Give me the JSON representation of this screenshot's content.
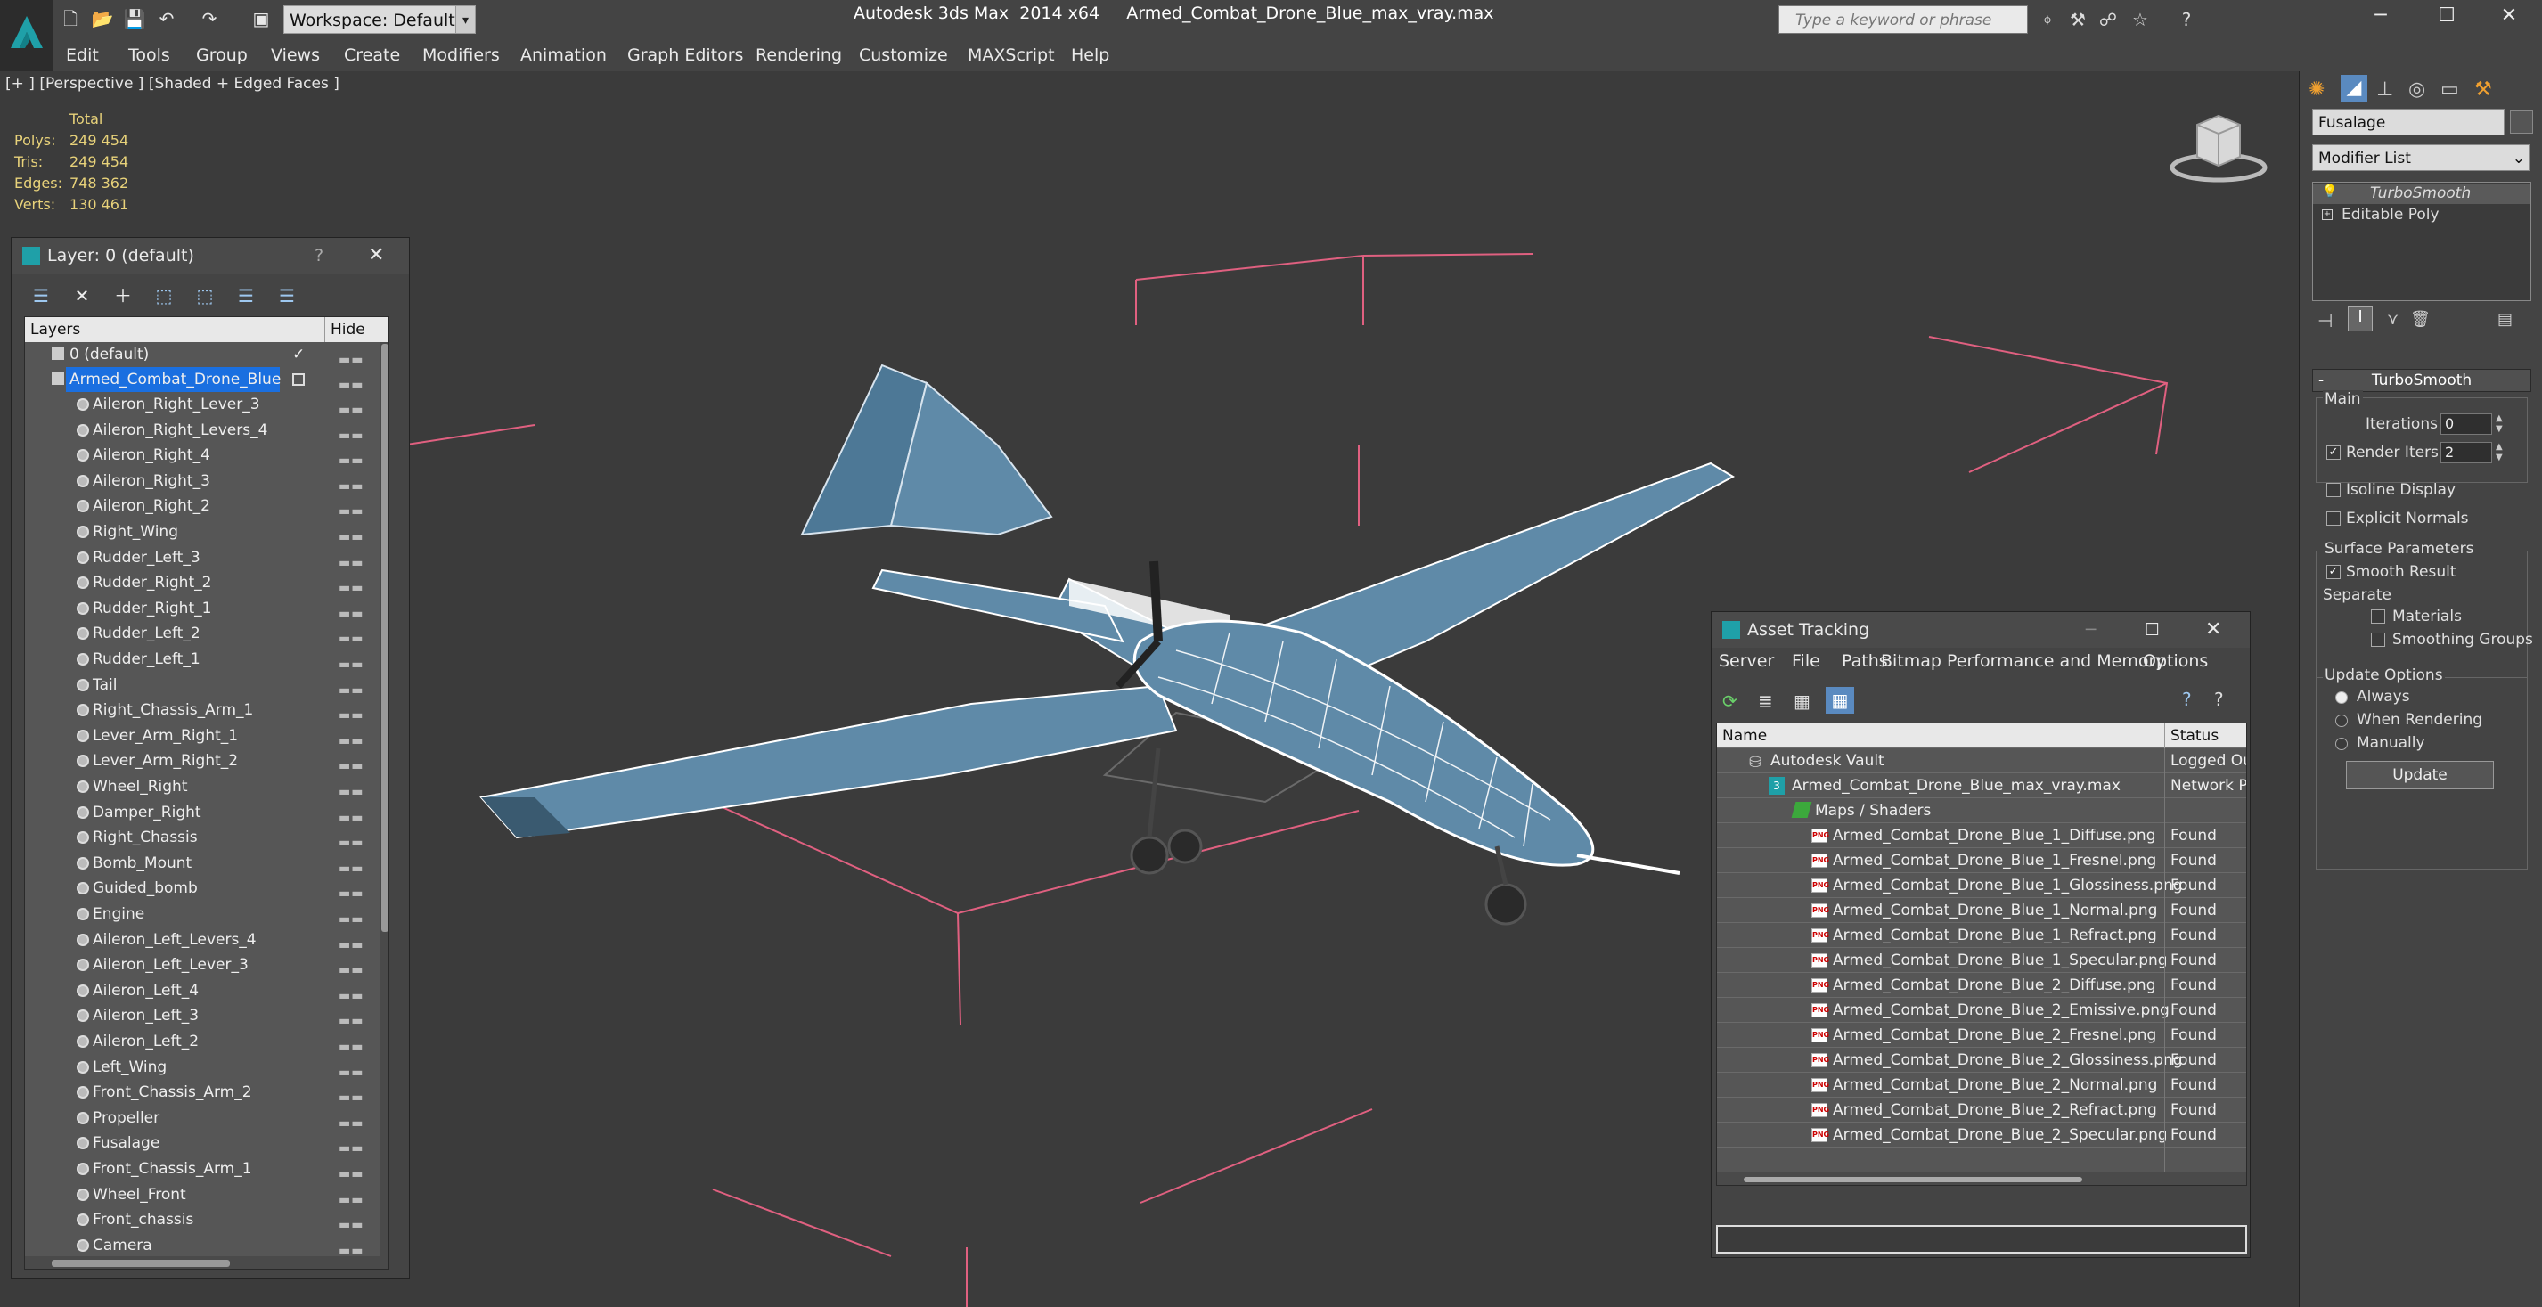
{
  "app": {
    "title": "Autodesk 3ds Max  2014 x64     Armed_Combat_Drone_Blue_max_vray.max",
    "workspace": "Workspace: Default",
    "search_placeholder": "Type a keyword or phrase"
  },
  "menu": [
    "Edit",
    "Tools",
    "Group",
    "Views",
    "Create",
    "Modifiers",
    "Animation",
    "Graph Editors",
    "Rendering",
    "Customize",
    "MAXScript",
    "Help"
  ],
  "viewport": {
    "label": "[+ ] [Perspective ] [Shaded + Edged Faces ]",
    "stats": {
      "header": "Total",
      "rows": [
        {
          "k": "Polys:",
          "v": "249 454"
        },
        {
          "k": "Tris:",
          "v": "249 454"
        },
        {
          "k": "Edges:",
          "v": "748 362"
        },
        {
          "k": "Verts:",
          "v": "130 461"
        }
      ]
    }
  },
  "layer_panel": {
    "title": "Layer: 0 (default)",
    "help": "?",
    "col_layers": "Layers",
    "col_hide": "Hide",
    "root": "0 (default)",
    "selected": "Armed_Combat_Drone_Blue",
    "items": [
      "Aileron_Right_Lever_3",
      "Aileron_Right_Levers_4",
      "Aileron_Right_4",
      "Aileron_Right_3",
      "Aileron_Right_2",
      "Right_Wing",
      "Rudder_Left_3",
      "Rudder_Right_2",
      "Rudder_Right_1",
      "Rudder_Left_2",
      "Rudder_Left_1",
      "Tail",
      "Right_Chassis_Arm_1",
      "Lever_Arm_Right_1",
      "Lever_Arm_Right_2",
      "Wheel_Right",
      "Damper_Right",
      "Right_Chassis",
      "Bomb_Mount",
      "Guided_bomb",
      "Engine",
      "Aileron_Left_Levers_4",
      "Aileron_Left_Lever_3",
      "Aileron_Left_4",
      "Aileron_Left_3",
      "Aileron_Left_2",
      "Left_Wing",
      "Front_Chassis_Arm_2",
      "Propeller",
      "Fusalage",
      "Front_Chassis_Arm_1",
      "Wheel_Front",
      "Front_chassis",
      "Camera"
    ]
  },
  "command_panel": {
    "object_name": "Fusalage",
    "modifier_list": "Modifier List",
    "stack": [
      "TurboSmooth",
      "Editable Poly"
    ],
    "rollout_title": "TurboSmooth",
    "main_label": "Main",
    "iterations_label": "Iterations:",
    "iterations_value": "0",
    "render_iters_label": "Render Iters:",
    "render_iters_value": "2",
    "isoline_label": "Isoline Display",
    "explicit_normals_label": "Explicit Normals",
    "surface_params_label": "Surface Parameters",
    "smooth_result_label": "Smooth Result",
    "separate_label": "Separate",
    "materials_label": "Materials",
    "smoothing_groups_label": "Smoothing Groups",
    "update_options_label": "Update Options",
    "always_label": "Always",
    "when_rendering_label": "When Rendering",
    "manually_label": "Manually",
    "update_button": "Update"
  },
  "asset_tracking": {
    "title": "Asset Tracking",
    "menu": [
      "Server",
      "File",
      "Paths",
      "Bitmap Performance and Memory",
      "Options"
    ],
    "col_name": "Name",
    "col_status": "Status",
    "vault": {
      "name": "Autodesk Vault",
      "status": "Logged Ou"
    },
    "file": {
      "name": "Armed_Combat_Drone_Blue_max_vray.max",
      "status": "Network P"
    },
    "group": "Maps / Shaders",
    "maps": [
      {
        "name": "Armed_Combat_Drone_Blue_1_Diffuse.png",
        "status": "Found"
      },
      {
        "name": "Armed_Combat_Drone_Blue_1_Fresnel.png",
        "status": "Found"
      },
      {
        "name": "Armed_Combat_Drone_Blue_1_Glossiness.png",
        "status": "Found"
      },
      {
        "name": "Armed_Combat_Drone_Blue_1_Normal.png",
        "status": "Found"
      },
      {
        "name": "Armed_Combat_Drone_Blue_1_Refract.png",
        "status": "Found"
      },
      {
        "name": "Armed_Combat_Drone_Blue_1_Specular.png",
        "status": "Found"
      },
      {
        "name": "Armed_Combat_Drone_Blue_2_Diffuse.png",
        "status": "Found"
      },
      {
        "name": "Armed_Combat_Drone_Blue_2_Emissive.png",
        "status": "Found"
      },
      {
        "name": "Armed_Combat_Drone_Blue_2_Fresnel.png",
        "status": "Found"
      },
      {
        "name": "Armed_Combat_Drone_Blue_2_Glossiness.png",
        "status": "Found"
      },
      {
        "name": "Armed_Combat_Drone_Blue_2_Normal.png",
        "status": "Found"
      },
      {
        "name": "Armed_Combat_Drone_Blue_2_Refract.png",
        "status": "Found"
      },
      {
        "name": "Armed_Combat_Drone_Blue_2_Specular.png",
        "status": "Found"
      }
    ]
  },
  "colors": {
    "accent": "#1a6fe0",
    "viewport_bg": "#3b3b3b",
    "stats_text": "#e8d27a",
    "bbox_lines": "#e06080",
    "model_fill": "#5f8aa8"
  }
}
